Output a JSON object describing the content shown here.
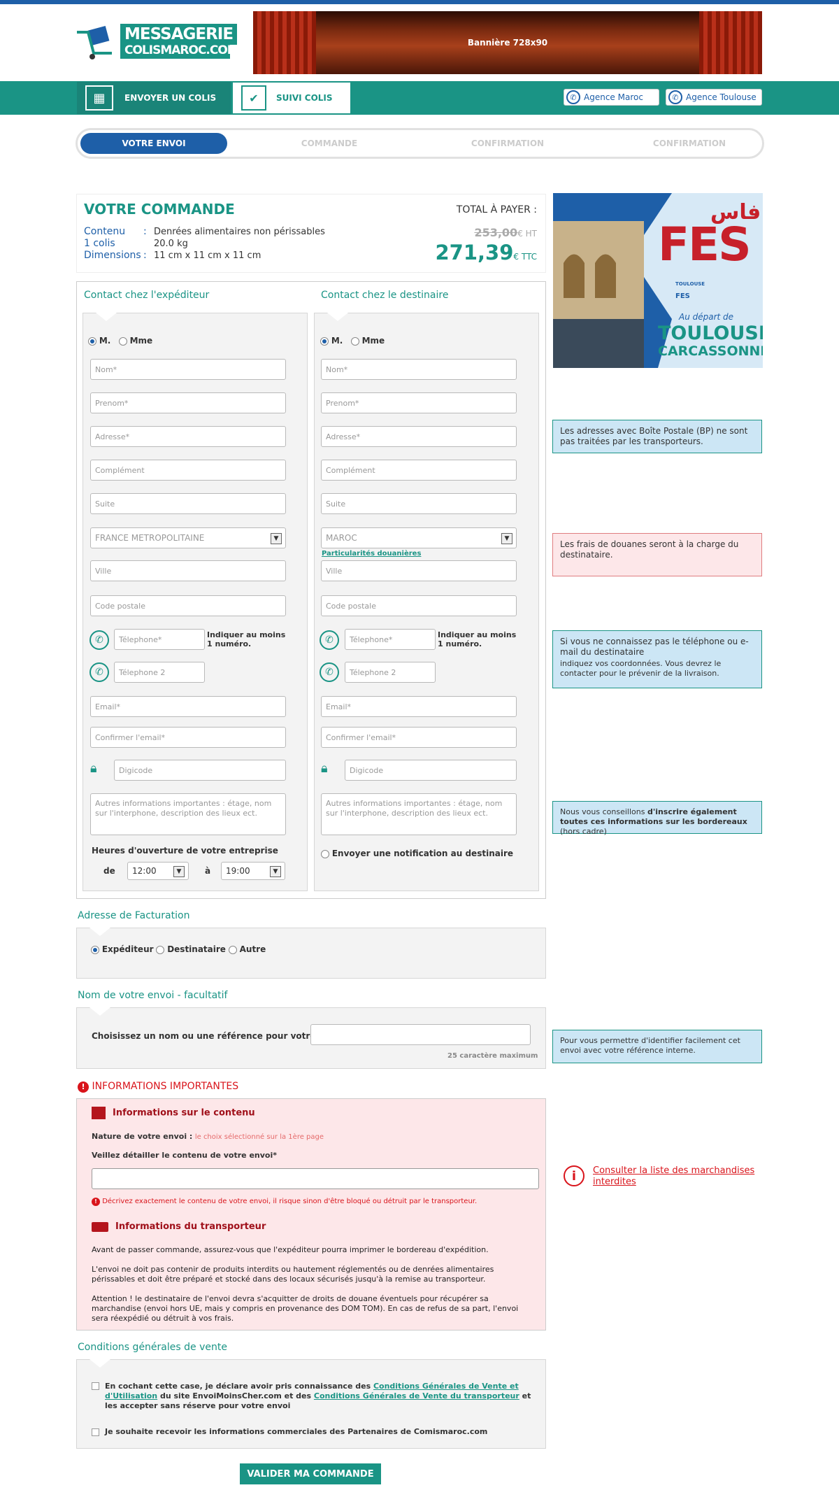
{
  "header": {
    "logo_line1": "MESSAGERIE",
    "logo_line2": "COLISMAROC.COM",
    "banner_text": "Bannière 728x90"
  },
  "nav": {
    "send": "ENVOYER UN COLIS",
    "track": "SUIVI COLIS",
    "agency_maroc": "Agence Maroc",
    "agency_toulouse": "Agence Toulouse"
  },
  "steps": [
    "VOTRE ENVOI",
    "COMMANDE",
    "CONFIRMATION",
    "CONFIRMATION"
  ],
  "order": {
    "title": "VOTRE COMMANDE",
    "total_label": "TOTAL À PAYER :",
    "contenu_label": "Contenu",
    "contenu_value": "Denrées alimentaires non périssables",
    "colis_label": "1 colis",
    "colis_value": "20.0 kg",
    "dim_label": "Dimensions",
    "dim_value": "11 cm x 11 cm x 11 cm",
    "price_ht": "253,00",
    "ht_suffix": "€ HT",
    "price_ttc": "271,39",
    "ttc_suffix": "€ TTC"
  },
  "promo": {
    "arabic": "فاس",
    "city": "FES",
    "line1": "TOULOUSE",
    "line2": "FES",
    "depart": "Au départ de",
    "from1": "TOULOUSE",
    "from2": "CARCASSONNE"
  },
  "sender": {
    "heading": "Contact chez l'expéditeur",
    "mr": "M.",
    "mme": "Mme",
    "nom": "Nom*",
    "prenom": "Prenom*",
    "adresse": "Adresse*",
    "complement": "Complément",
    "suite": "Suite",
    "country": "FRANCE METROPOLITAINE",
    "ville": "Ville",
    "cp": "Code postale",
    "tel": "Télephone*",
    "tel_hint": "Indiquer au moins 1 numéro.",
    "tel2": "Télephone 2",
    "email": "Email*",
    "email_confirm": "Confirmer l'email*",
    "digicode": "Digicode",
    "notes": "Autres informations importantes : étage, nom sur l'interphone, description des lieux ect.",
    "hours_label": "Heures d'ouverture de votre entreprise",
    "from_label": "de",
    "from_value": "12:00",
    "to_label": "à",
    "to_value": "19:00"
  },
  "recipient": {
    "heading": "Contact chez le destinaire",
    "mr": "M.",
    "mme": "Mme",
    "nom": "Nom*",
    "prenom": "Prenom*",
    "adresse": "Adresse*",
    "complement": "Complément",
    "suite": "Suite",
    "country": "MAROC",
    "customs_link": "Particularités douanières",
    "ville": "Ville",
    "cp": "Code postale",
    "tel": "Télephone*",
    "tel_hint": "Indiquer au moins 1 numéro.",
    "tel2": "Télephone 2",
    "email": "Email*",
    "email_confirm": "Confirmer l'email*",
    "digicode": "Digicode",
    "notes": "Autres informations importantes : étage, nom sur l'interphone, description des lieux ect.",
    "notify": "Envoyer une notification au destinaire"
  },
  "side_notes": {
    "bp": "Les adresses avec Boîte Postale (BP) ne sont pas traitées par les transporteurs.",
    "douane": "Les frais de douanes seront à la charge du destinataire.",
    "phone_title": "Si vous ne connaissez pas le téléphone ou e-mail du destinataire",
    "phone_sub": "indiquez vos coordonnées. Vous devrez le contacter pour le prévenir de la livraison.",
    "bordereau_a": "Nous vous conseillons ",
    "bordereau_b": "d'inscrire également toutes ces informations sur les bordereaux",
    "bordereau_c": " (hors cadre)",
    "reference": "Pour vous permettre d'identifier facilement cet envoi avec votre référence interne.",
    "forbidden": "Consulter la liste des marchandises interdites"
  },
  "billing": {
    "heading": "Adresse de Facturation",
    "opt1": "Expéditeur",
    "opt2": "Destinataire",
    "opt3": "Autre"
  },
  "name_section": {
    "heading": "Nom de votre envoi - facultatif",
    "label": "Choisissez un nom ou une référence pour votre envoi",
    "max": "25 caractère maximum"
  },
  "important": {
    "heading": "INFORMATIONS IMPORTANTES",
    "content_title": "Informations sur le contenu",
    "nature_label": "Nature de votre envoi :",
    "nature_value": "le choix sélectionné sur la 1ère page",
    "detail_label": "Veillez détailler le contenu de votre envoi*",
    "warning": "Décrivez exactement le contenu de votre envoi, il risque sinon d'être bloqué ou détruit par le transporteur.",
    "carrier_title": "Informations du transporteur",
    "p1": "Avant de passer commande, assurez-vous que l'expéditeur pourra imprimer le bordereau d'expédition.",
    "p2": "L'envoi ne doit pas contenir de produits interdits ou hautement réglementés ou de denrées alimentaires périssables et doit être préparé et stocké dans des locaux sécurisés jusqu'à la remise au transporteur.",
    "p3": "Attention ! le destinataire de l'envoi devra s'acquitter de droits de douane éventuels pour récupérer sa marchandise (envoi hors UE, mais y compris en provenance des DOM TOM). En cas de refus de sa part, l'envoi sera réexpédié ou détruit à vos frais."
  },
  "cgv": {
    "heading": "Conditions générales de vente",
    "c1_a": "En cochant cette case, je déclare avoir pris connaissance des ",
    "c1_link1": "Conditions Générales de Vente et d'Utilisation",
    "c1_b": " du site EnvoiMoinsCher.com et des ",
    "c1_link2": "Conditions Générales de Vente du transporteur",
    "c1_c": " et les accepter sans réserve pour votre envoi",
    "c2": "Je souhaite recevoir les informations commerciales des Partenaires de Comismaroc.com"
  },
  "submit": "VALIDER MA COMMANDE",
  "colors": {
    "teal": "#1a9485",
    "blue": "#1e5fa8",
    "red": "#d9141b"
  }
}
